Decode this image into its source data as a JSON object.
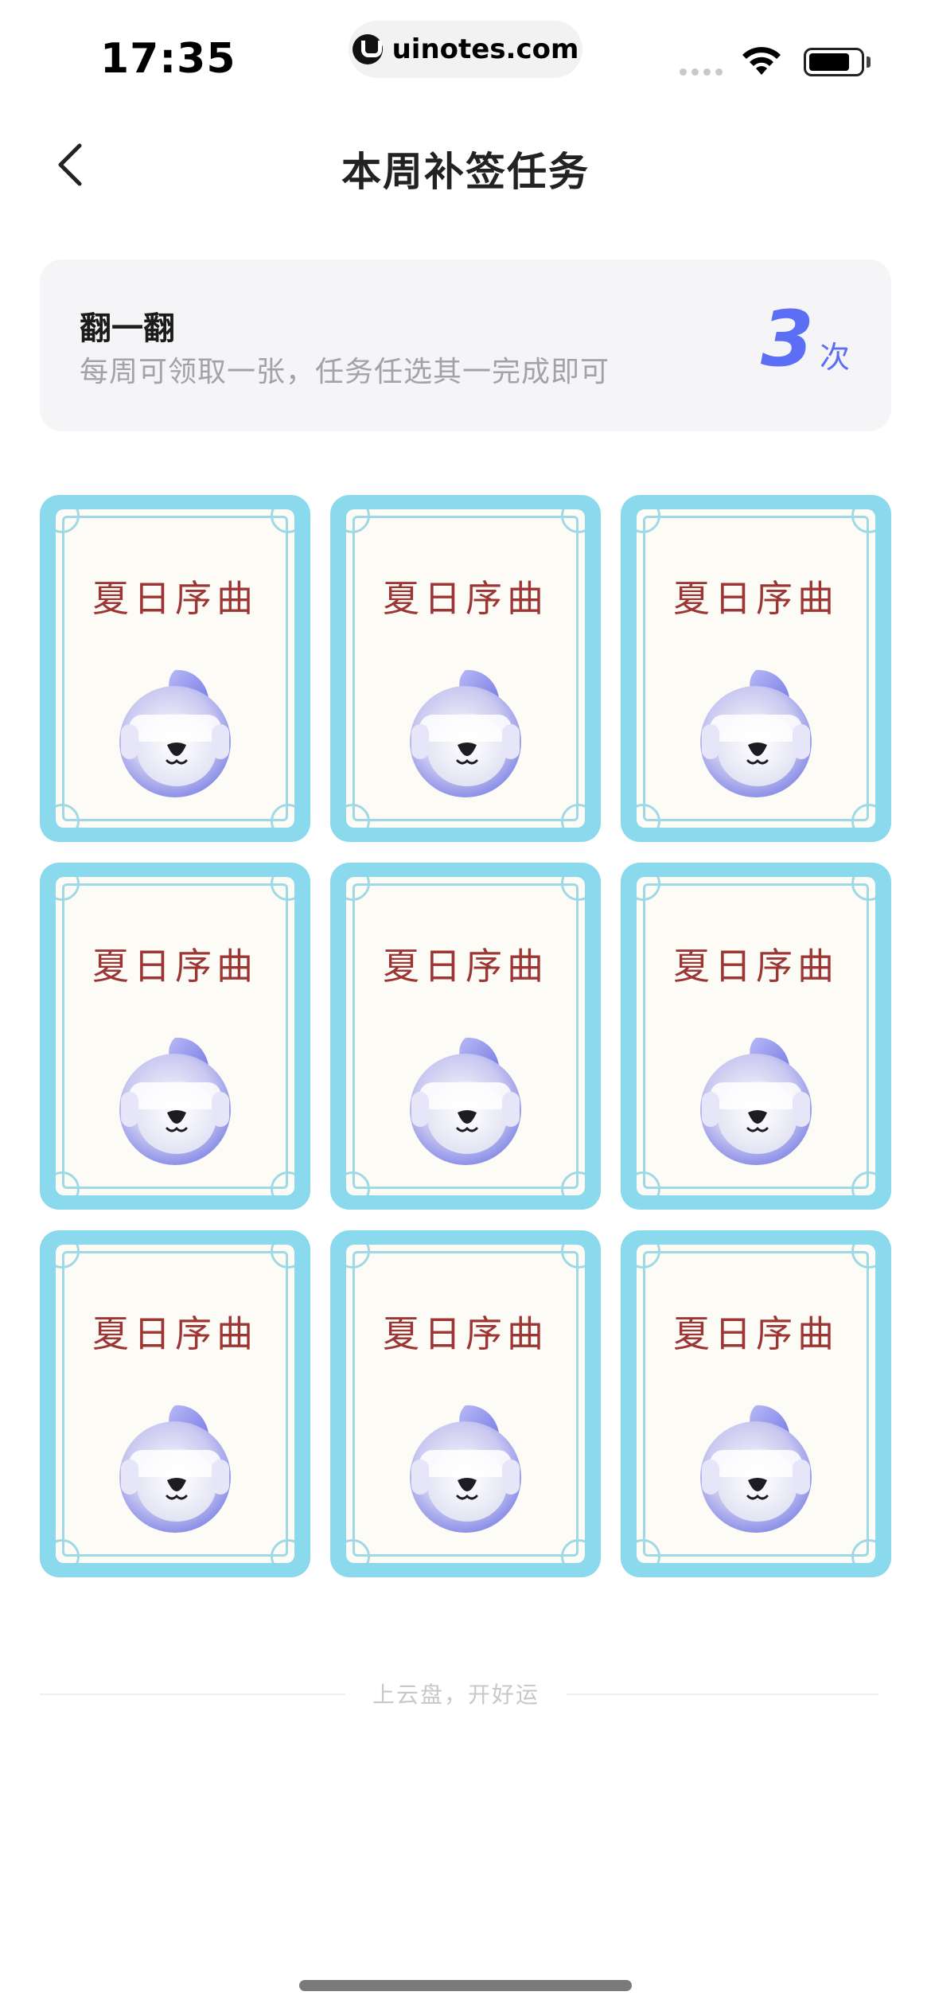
{
  "status_bar": {
    "time": "17:35",
    "url": "uinotes.com",
    "icons": [
      "signal-icon",
      "wifi-icon",
      "battery-icon"
    ]
  },
  "nav": {
    "back_icon": "chevron-left-icon",
    "title": "本周补签任务"
  },
  "summary": {
    "title": "翻一翻",
    "description": "每周可领取一张，任务任选其一完成即可",
    "count": "3",
    "unit": "次"
  },
  "cards": [
    {
      "title": "夏日序曲"
    },
    {
      "title": "夏日序曲"
    },
    {
      "title": "夏日序曲"
    },
    {
      "title": "夏日序曲"
    },
    {
      "title": "夏日序曲"
    },
    {
      "title": "夏日序曲"
    },
    {
      "title": "夏日序曲"
    },
    {
      "title": "夏日序曲"
    },
    {
      "title": "夏日序曲"
    }
  ],
  "footer": {
    "text": "上云盘，开好运"
  },
  "colors": {
    "accent": "#5b6ef5",
    "card_border": "#8ad9ec",
    "card_title": "#9c3634"
  }
}
